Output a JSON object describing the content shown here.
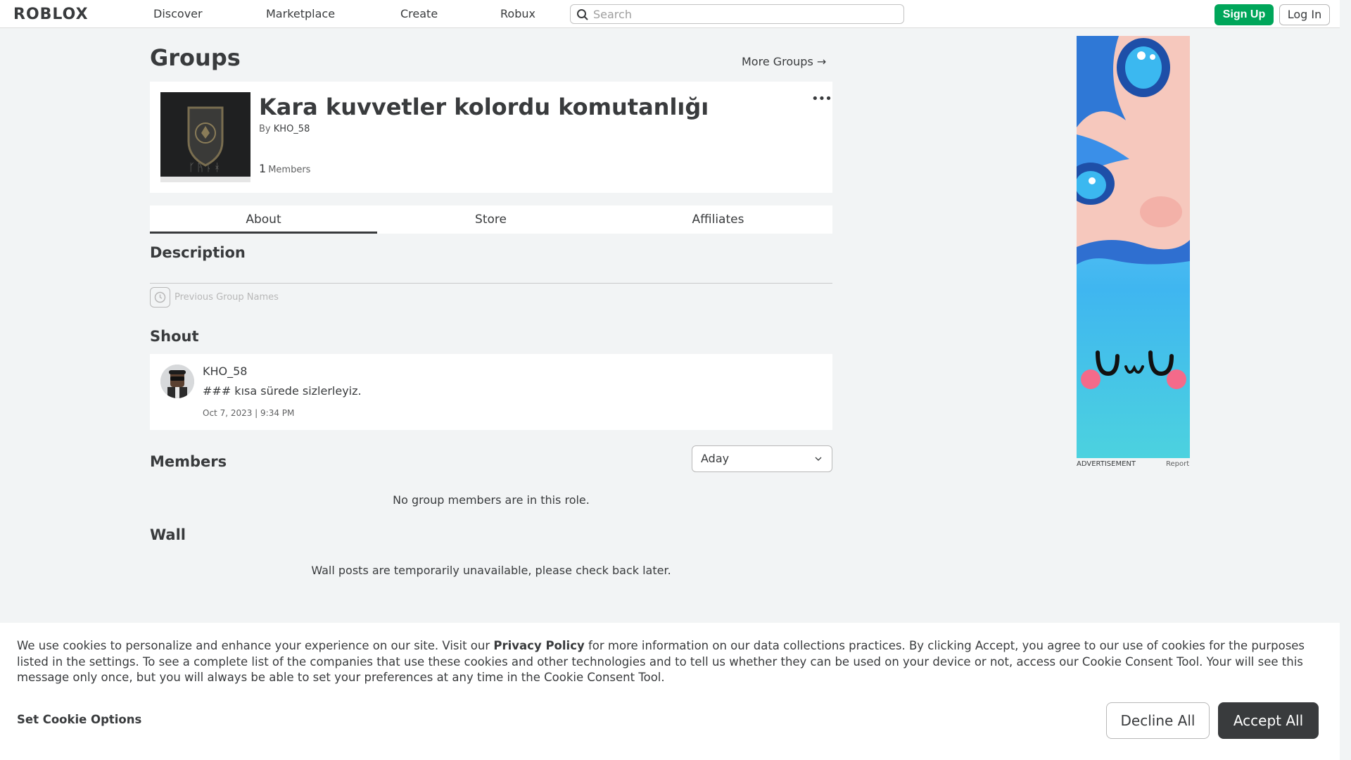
{
  "nav": {
    "logo": "ROBLOX",
    "links": [
      "Discover",
      "Marketplace",
      "Create",
      "Robux"
    ],
    "search_placeholder": "Search",
    "signup_label": "Sign Up",
    "login_label": "Log In"
  },
  "main": {
    "page_title": "Groups",
    "more_groups": "More Groups →",
    "group": {
      "name": "Kara kuvvetler kolordu komutanlığı",
      "by_label": "By",
      "owner": "KHO_58",
      "member_count": "1",
      "members_label": "Members",
      "menu_glyph": "•••"
    },
    "tabs": [
      "About",
      "Store",
      "Affiliates"
    ],
    "description_heading": "Description",
    "previous_names_label": "Previous Group Names",
    "shout": {
      "heading": "Shout",
      "poster": "KHO_58",
      "text": "### kısa sürede sizlerleyiz.",
      "date": "Oct 7, 2023 | 9:34 PM"
    },
    "members": {
      "heading": "Members",
      "role_selected": "Aday",
      "empty_text": "No group members are in this role."
    },
    "wall": {
      "heading": "Wall",
      "message": "Wall posts are temporarily unavailable, please check back later."
    }
  },
  "ad": {
    "label": "ADVERTISEMENT",
    "report": "Report"
  },
  "cookie": {
    "text_before": "We use cookies to personalize and enhance your experience on our site. Visit our ",
    "policy_link": "Privacy Policy",
    "text_after": " for more information on our data collections practices. By clicking Accept, you agree to our use of cookies for the purposes listed in the settings. To see a complete list of the companies that use these cookies and other technologies and to tell us whether they can be used on your device or not, access our Cookie Consent Tool. Your will see this message only once, but you will always be able to set your preferences at any time in the Cookie Consent Tool.",
    "options_label": "Set Cookie Options",
    "decline_label": "Decline All",
    "accept_label": "Accept All"
  },
  "colors": {
    "brand_green": "#00a65a",
    "text_dark": "#393b3d",
    "background": "#f2f4f5"
  }
}
